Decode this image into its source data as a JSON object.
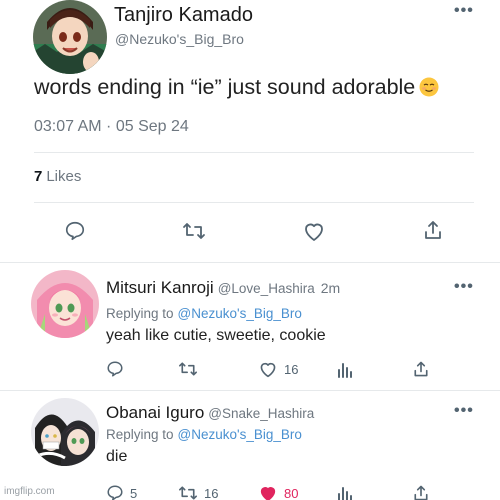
{
  "main_tweet": {
    "name": "Tanjiro Kamado",
    "handle": "@Nezuko's_Big_Bro",
    "text": "words ending in “ie” just sound adorable",
    "emoji": "relieved-face-emoji",
    "timestamp": "03:07 AM · 05 Sep 24",
    "likes_count": "7",
    "likes_label": "Likes",
    "actions": [
      "reply-icon",
      "retweet-icon",
      "like-icon",
      "share-icon"
    ]
  },
  "replies": [
    {
      "name": "Mitsuri Kanroji",
      "handle": "@Love_Hashira",
      "time": "2m",
      "replying_label": "Replying to",
      "replying_handle": "@Nezuko's_Big_Bro",
      "text": "yeah like cutie, sweetie, cookie",
      "retweets": "",
      "likes": "16",
      "liked": false
    },
    {
      "name": "Obanai Iguro",
      "handle": "@Snake_Hashira",
      "time": "",
      "replying_label": "Replying to",
      "replying_handle": "@Nezuko's_Big_Bro",
      "text": "die",
      "replies_count": "5",
      "retweets": "16",
      "likes": "80",
      "liked": true
    }
  ],
  "watermark": "imgflip.com",
  "colors": {
    "text": "#0f1419",
    "muted": "#6e7780",
    "link": "#4a90d0",
    "like_active": "#e0245e"
  }
}
